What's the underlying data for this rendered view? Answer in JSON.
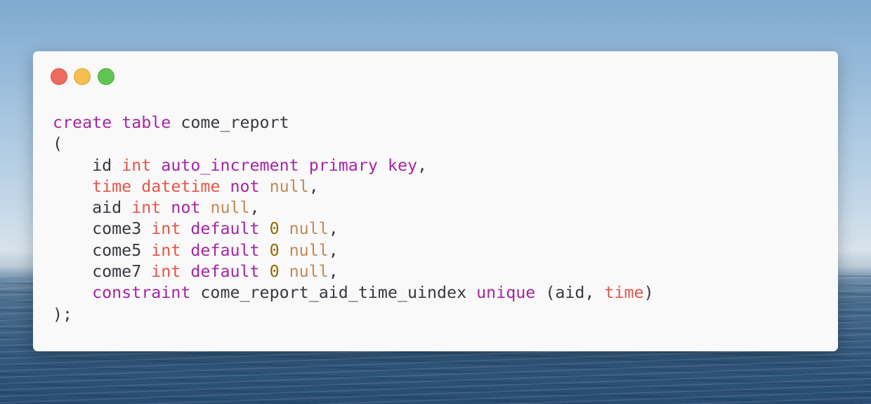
{
  "window": {
    "controls": [
      "close",
      "minimize",
      "zoom"
    ],
    "colors": {
      "close": "#ed6a5e",
      "minimize": "#f5bf4f",
      "zoom": "#61c554"
    }
  },
  "syntax_colors": {
    "keyword": "#a626a4",
    "type": "#e45649",
    "null": "#c18a55",
    "number": "#986801",
    "text": "#383a42"
  },
  "code_lines": [
    [
      {
        "t": "create",
        "c": "kw"
      },
      {
        "t": " ",
        "c": "punc"
      },
      {
        "t": "table",
        "c": "kw"
      },
      {
        "t": " come_report",
        "c": "id"
      }
    ],
    [
      {
        "t": "(",
        "c": "punc"
      }
    ],
    [
      {
        "t": "    id ",
        "c": "id"
      },
      {
        "t": "int",
        "c": "type"
      },
      {
        "t": " ",
        "c": "punc"
      },
      {
        "t": "auto_increment",
        "c": "kw"
      },
      {
        "t": " ",
        "c": "punc"
      },
      {
        "t": "primary",
        "c": "kw"
      },
      {
        "t": " ",
        "c": "punc"
      },
      {
        "t": "key",
        "c": "kw"
      },
      {
        "t": ",",
        "c": "punc"
      }
    ],
    [
      {
        "t": "    ",
        "c": "punc"
      },
      {
        "t": "time",
        "c": "type"
      },
      {
        "t": " ",
        "c": "punc"
      },
      {
        "t": "datetime",
        "c": "type"
      },
      {
        "t": " ",
        "c": "punc"
      },
      {
        "t": "not",
        "c": "kw"
      },
      {
        "t": " ",
        "c": "punc"
      },
      {
        "t": "null",
        "c": "null"
      },
      {
        "t": ",",
        "c": "punc"
      }
    ],
    [
      {
        "t": "    aid ",
        "c": "id"
      },
      {
        "t": "int",
        "c": "type"
      },
      {
        "t": " ",
        "c": "punc"
      },
      {
        "t": "not",
        "c": "kw"
      },
      {
        "t": " ",
        "c": "punc"
      },
      {
        "t": "null",
        "c": "null"
      },
      {
        "t": ",",
        "c": "punc"
      }
    ],
    [
      {
        "t": "    come3 ",
        "c": "id"
      },
      {
        "t": "int",
        "c": "type"
      },
      {
        "t": " ",
        "c": "punc"
      },
      {
        "t": "default",
        "c": "kw"
      },
      {
        "t": " ",
        "c": "punc"
      },
      {
        "t": "0",
        "c": "num"
      },
      {
        "t": " ",
        "c": "punc"
      },
      {
        "t": "null",
        "c": "null"
      },
      {
        "t": ",",
        "c": "punc"
      }
    ],
    [
      {
        "t": "    come5 ",
        "c": "id"
      },
      {
        "t": "int",
        "c": "type"
      },
      {
        "t": " ",
        "c": "punc"
      },
      {
        "t": "default",
        "c": "kw"
      },
      {
        "t": " ",
        "c": "punc"
      },
      {
        "t": "0",
        "c": "num"
      },
      {
        "t": " ",
        "c": "punc"
      },
      {
        "t": "null",
        "c": "null"
      },
      {
        "t": ",",
        "c": "punc"
      }
    ],
    [
      {
        "t": "    come7 ",
        "c": "id"
      },
      {
        "t": "int",
        "c": "type"
      },
      {
        "t": " ",
        "c": "punc"
      },
      {
        "t": "default",
        "c": "kw"
      },
      {
        "t": " ",
        "c": "punc"
      },
      {
        "t": "0",
        "c": "num"
      },
      {
        "t": " ",
        "c": "punc"
      },
      {
        "t": "null",
        "c": "null"
      },
      {
        "t": ",",
        "c": "punc"
      }
    ],
    [
      {
        "t": "    ",
        "c": "punc"
      },
      {
        "t": "constraint",
        "c": "kw"
      },
      {
        "t": " come_report_aid_time_uindex ",
        "c": "id"
      },
      {
        "t": "unique",
        "c": "kw"
      },
      {
        "t": " (aid, ",
        "c": "punc"
      },
      {
        "t": "time",
        "c": "type"
      },
      {
        "t": ")",
        "c": "punc"
      }
    ],
    [
      {
        "t": ");",
        "c": "punc"
      }
    ]
  ]
}
